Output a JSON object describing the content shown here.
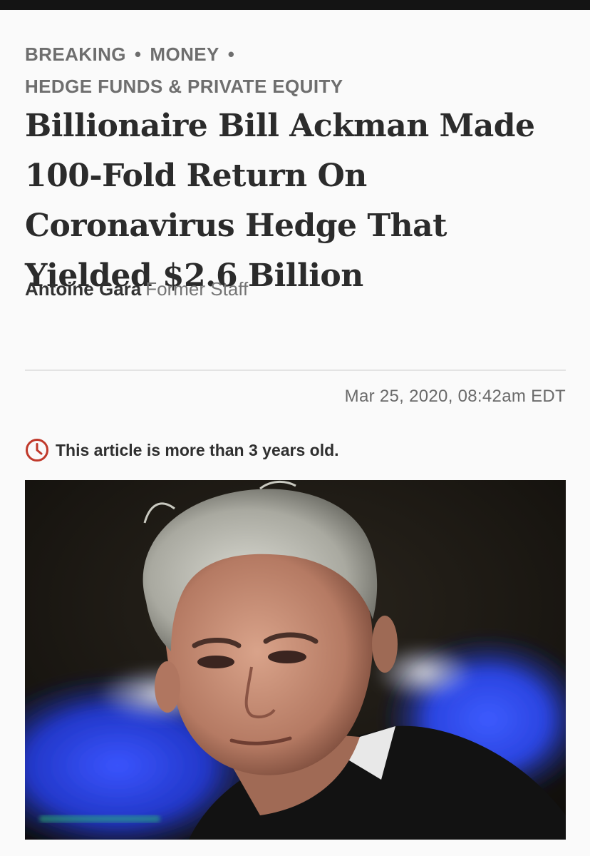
{
  "breadcrumb": {
    "items": [
      "BREAKING",
      "MONEY",
      "HEDGE FUNDS & PRIVATE EQUITY"
    ],
    "separator": "•"
  },
  "article": {
    "headline": "Billionaire Bill Ackman Made 100-Fold Return On Coronavirus Hedge That Yielded $2.6 Billion",
    "author_name": "Antoine Gara",
    "author_role": "Former Staff",
    "timestamp": "Mar 25, 2020, 08:42am EDT",
    "age_notice": "This article is more than 3 years old."
  },
  "icons": {
    "age_notice_icon": "clock-icon"
  },
  "colors": {
    "top_bar": "#141414",
    "background": "#fafafa",
    "breadcrumb": "#6e6e6e",
    "headline": "#2b2b2b",
    "notice_icon": "#c0392b"
  }
}
